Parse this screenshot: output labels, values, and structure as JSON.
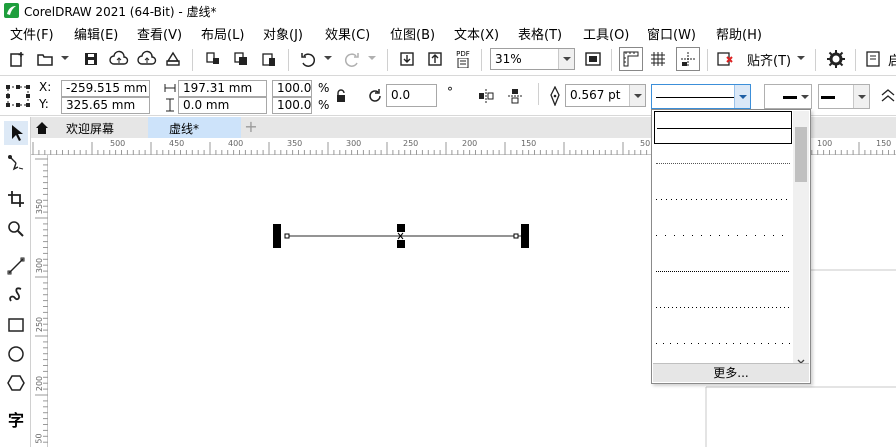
{
  "window": {
    "title": "CorelDRAW 2021 (64-Bit) - 虚线*"
  },
  "menu": [
    "文件(F)",
    "编辑(E)",
    "查看(V)",
    "布局(L)",
    "对象(J)",
    "效果(C)",
    "位图(B)",
    "文本(X)",
    "表格(T)",
    "工具(O)",
    "窗口(W)",
    "帮助(H)"
  ],
  "toolbar": {
    "zoom": "31%",
    "snap_label": "贴齐(T)",
    "pdf_label": "PDF",
    "truncated_label": "启"
  },
  "properties": {
    "x_label": "X:",
    "y_label": "Y:",
    "x_value": "-259.515 mm",
    "y_value": "325.65 mm",
    "width_value": "197.31 mm",
    "height_value": "0.0 mm",
    "scale_x": "100.0",
    "scale_y": "100.0",
    "percent": "%",
    "rotation": "0.0",
    "degree_symbol": "°",
    "outline_width": "0.567 pt"
  },
  "tabs": {
    "welcome": "欢迎屏幕",
    "document": "虚线*"
  },
  "ruler": {
    "h_ticks": [
      "500",
      "450",
      "400",
      "350",
      "300",
      "250",
      "200",
      "150",
      "50",
      "100",
      "150"
    ],
    "v_ticks": [
      "350",
      "300",
      "250",
      "200",
      "50"
    ]
  },
  "line_style_dropdown": {
    "more_label": "更多...",
    "styles": [
      "solid",
      "fine-dots",
      "dots",
      "sparse-dots",
      "dense-dots",
      "medium-dots",
      "wide-dots"
    ]
  },
  "tool_text_label": "字",
  "colors": {
    "accent": "#3c8fd9",
    "active_tab": "#cde3fa",
    "logo": "#1e9e3c"
  }
}
